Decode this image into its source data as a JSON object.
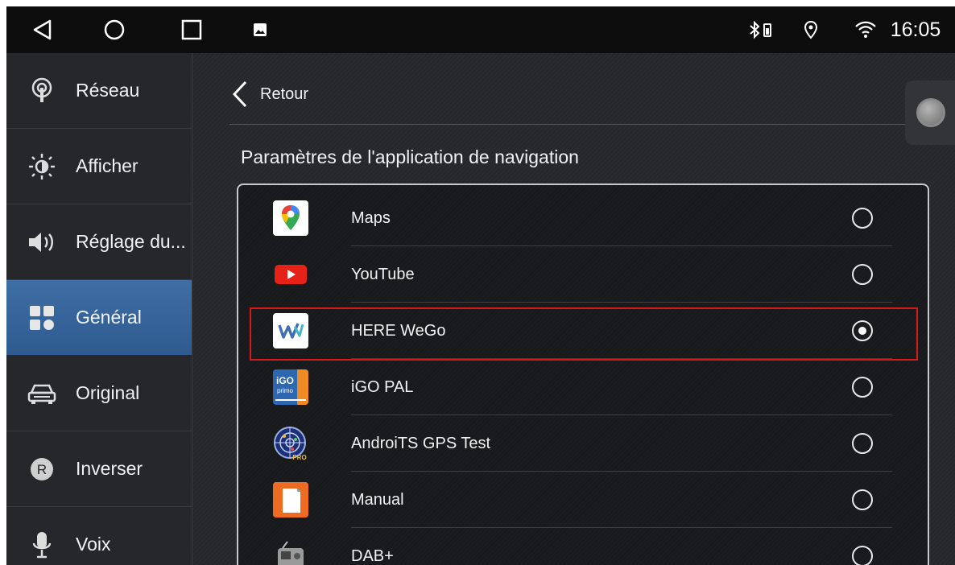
{
  "statusbar": {
    "time": "16:05",
    "icons": [
      "back-nav-icon",
      "home-nav-icon",
      "recents-nav-icon",
      "image-notification-icon",
      "bluetooth-icon",
      "location-icon",
      "wifi-icon"
    ]
  },
  "sidebar": {
    "items": [
      {
        "label": "Réseau",
        "icon": "network-icon"
      },
      {
        "label": "Afficher",
        "icon": "brightness-icon"
      },
      {
        "label": "Réglage du...",
        "icon": "speaker-icon"
      },
      {
        "label": "Général",
        "icon": "grid-icon",
        "active": true
      },
      {
        "label": "Original",
        "icon": "car-icon"
      },
      {
        "label": "Inverser",
        "icon": "reverse-r-icon"
      },
      {
        "label": "Voix",
        "icon": "microphone-icon"
      }
    ]
  },
  "main": {
    "back_label": "Retour",
    "section_title": "Paramètres de l'application de navigation",
    "apps": [
      {
        "name": "Maps",
        "selected": false
      },
      {
        "name": "YouTube",
        "selected": false
      },
      {
        "name": "HERE WeGo",
        "selected": true
      },
      {
        "name": "iGO PAL",
        "selected": false
      },
      {
        "name": "AndroiTS GPS Test",
        "selected": false
      },
      {
        "name": "Manual",
        "selected": false
      },
      {
        "name": "DAB+",
        "selected": false
      }
    ]
  },
  "colors": {
    "active_tab": "#3f6fa5",
    "highlight": "#d61a1a",
    "background": "#1c1d20"
  }
}
